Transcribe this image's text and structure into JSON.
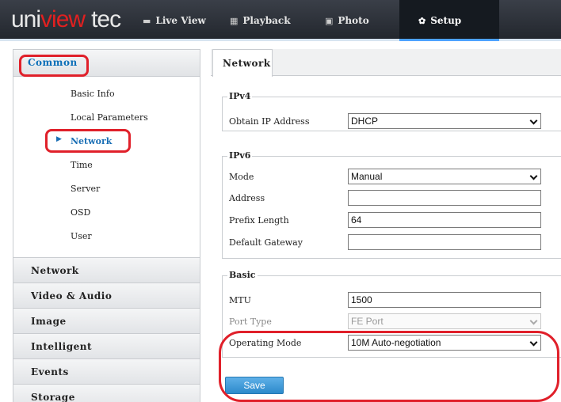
{
  "brand": {
    "part1": "uni",
    "part2": "view",
    "part3": "tec"
  },
  "nav": {
    "items": [
      {
        "label": "Live View",
        "icon": "monitor-icon",
        "glyph": "▬"
      },
      {
        "label": "Playback",
        "icon": "film-icon",
        "glyph": "▦"
      },
      {
        "label": "Photo",
        "icon": "photo-icon",
        "glyph": "▣"
      },
      {
        "label": "Setup",
        "icon": "gear-icon",
        "glyph": "✿"
      }
    ],
    "active": "Setup"
  },
  "sidebar": {
    "header": "Common",
    "sub_items": [
      "Basic Info",
      "Local Parameters",
      "Network",
      "Time",
      "Server",
      "OSD",
      "User"
    ],
    "selected": "Network",
    "sections": [
      "Network",
      "Video & Audio",
      "Image",
      "Intelligent",
      "Events",
      "Storage"
    ]
  },
  "main": {
    "tab": "Network",
    "ipv4": {
      "legend": "IPv4",
      "obtain_label": "Obtain IP Address",
      "obtain_value": "DHCP"
    },
    "ipv6": {
      "legend": "IPv6",
      "mode_label": "Mode",
      "mode_value": "Manual",
      "address_label": "Address",
      "address_value": "",
      "prefix_label": "Prefix Length",
      "prefix_value": "64",
      "gateway_label": "Default Gateway",
      "gateway_value": ""
    },
    "basic": {
      "legend": "Basic",
      "mtu_label": "MTU",
      "mtu_value": "1500",
      "port_type_label": "Port Type",
      "port_type_value": "FE Port",
      "operating_mode_label": "Operating Mode",
      "operating_mode_value": "10M Auto-negotiation"
    },
    "save_label": "Save"
  },
  "colors": {
    "accent": "#1a6fb5",
    "highlight": "#e0202a",
    "save_button": "#2c8acb"
  }
}
